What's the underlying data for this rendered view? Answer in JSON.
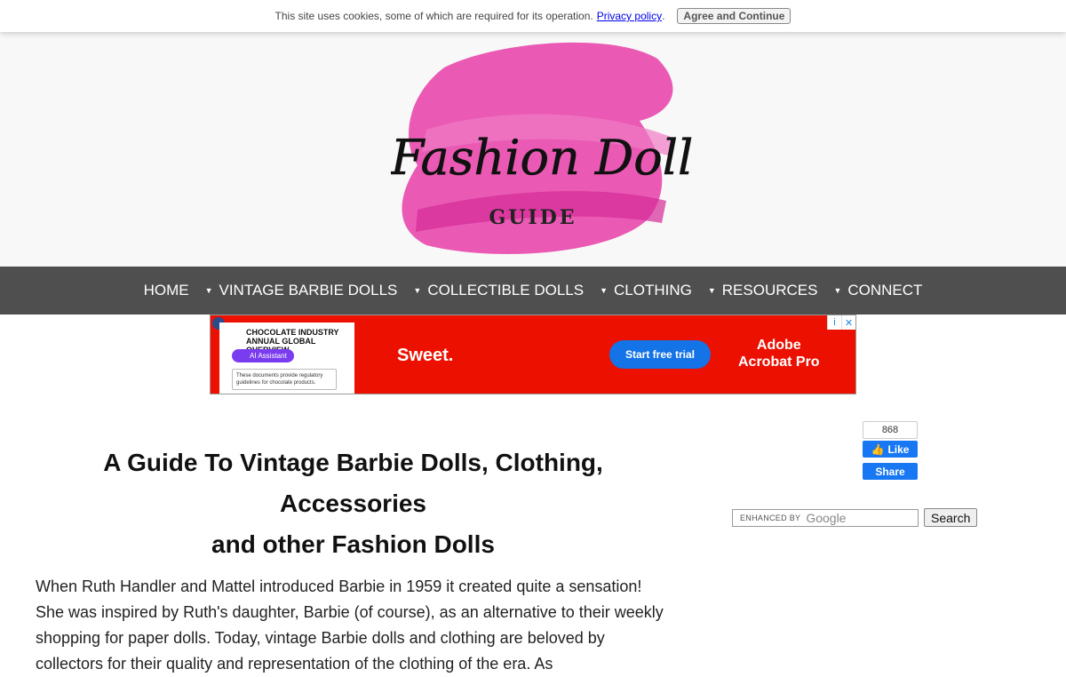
{
  "cookie_bar": {
    "message": "This site uses cookies, some of which are required for its operation.",
    "privacy_link": "Privacy policy",
    "period": ".",
    "agree_button": "Agree and Continue"
  },
  "logo": {
    "script_text": "Fashion Doll",
    "sub_text": "GUIDE",
    "accent_color": "#e83ea8"
  },
  "nav": {
    "items": [
      {
        "label": "HOME",
        "has_dropdown": false
      },
      {
        "label": "VINTAGE BARBIE DOLLS",
        "has_dropdown": true
      },
      {
        "label": "COLLECTIBLE DOLLS",
        "has_dropdown": true
      },
      {
        "label": "CLOTHING",
        "has_dropdown": true
      },
      {
        "label": "RESOURCES",
        "has_dropdown": true
      },
      {
        "label": "CONNECT",
        "has_dropdown": true
      }
    ],
    "background": "#4f4f4f"
  },
  "ad": {
    "doc_title": "CHOCOLATE INDUSTRY ANNUAL GLOBAL OVERVIEW",
    "assistant_pill": "AI Assistant",
    "doc_note": "These documents provide regulatory guidelines for chocolate products.",
    "tagline": "Sweet.",
    "cta": "Start free trial",
    "brand_line1": "Adobe",
    "brand_line2": "Acrobat Pro",
    "info_glyph": "i",
    "close_glyph": "✕",
    "background": "#eb1000"
  },
  "main": {
    "headline_line1": "A Guide To Vintage Barbie Dolls, Clothing,",
    "headline_line2": "Accessories",
    "headline_line3": "and other Fashion Dolls",
    "intro": "When Ruth Handler and Mattel introduced Barbie in 1959 it created quite a sensation! She was inspired by Ruth's daughter, Barbie (of course), as an alternative to their weekly shopping for paper dolls. Today, vintage Barbie dolls and clothing are beloved by collectors for their quality and representation of the clothing of the era. As"
  },
  "sidebar": {
    "fb_count": "868",
    "fb_like": "Like",
    "fb_share": "Share",
    "search_enhanced": "ENHANCED BY",
    "search_google": "Google",
    "search_button": "Search"
  }
}
